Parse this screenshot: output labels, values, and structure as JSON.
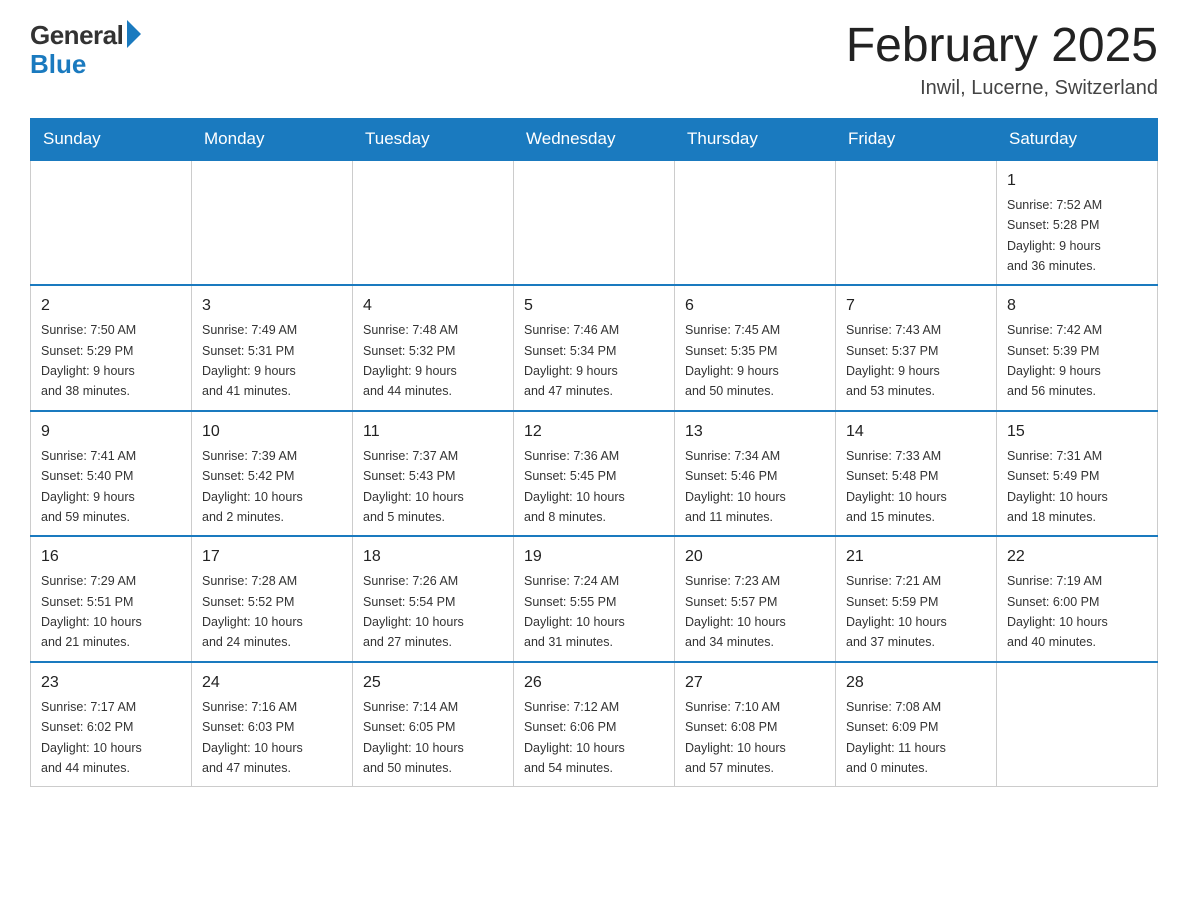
{
  "logo": {
    "general": "General",
    "blue": "Blue"
  },
  "title": "February 2025",
  "subtitle": "Inwil, Lucerne, Switzerland",
  "weekdays": [
    "Sunday",
    "Monday",
    "Tuesday",
    "Wednesday",
    "Thursday",
    "Friday",
    "Saturday"
  ],
  "weeks": [
    [
      {
        "day": "",
        "info": ""
      },
      {
        "day": "",
        "info": ""
      },
      {
        "day": "",
        "info": ""
      },
      {
        "day": "",
        "info": ""
      },
      {
        "day": "",
        "info": ""
      },
      {
        "day": "",
        "info": ""
      },
      {
        "day": "1",
        "info": "Sunrise: 7:52 AM\nSunset: 5:28 PM\nDaylight: 9 hours\nand 36 minutes."
      }
    ],
    [
      {
        "day": "2",
        "info": "Sunrise: 7:50 AM\nSunset: 5:29 PM\nDaylight: 9 hours\nand 38 minutes."
      },
      {
        "day": "3",
        "info": "Sunrise: 7:49 AM\nSunset: 5:31 PM\nDaylight: 9 hours\nand 41 minutes."
      },
      {
        "day": "4",
        "info": "Sunrise: 7:48 AM\nSunset: 5:32 PM\nDaylight: 9 hours\nand 44 minutes."
      },
      {
        "day": "5",
        "info": "Sunrise: 7:46 AM\nSunset: 5:34 PM\nDaylight: 9 hours\nand 47 minutes."
      },
      {
        "day": "6",
        "info": "Sunrise: 7:45 AM\nSunset: 5:35 PM\nDaylight: 9 hours\nand 50 minutes."
      },
      {
        "day": "7",
        "info": "Sunrise: 7:43 AM\nSunset: 5:37 PM\nDaylight: 9 hours\nand 53 minutes."
      },
      {
        "day": "8",
        "info": "Sunrise: 7:42 AM\nSunset: 5:39 PM\nDaylight: 9 hours\nand 56 minutes."
      }
    ],
    [
      {
        "day": "9",
        "info": "Sunrise: 7:41 AM\nSunset: 5:40 PM\nDaylight: 9 hours\nand 59 minutes."
      },
      {
        "day": "10",
        "info": "Sunrise: 7:39 AM\nSunset: 5:42 PM\nDaylight: 10 hours\nand 2 minutes."
      },
      {
        "day": "11",
        "info": "Sunrise: 7:37 AM\nSunset: 5:43 PM\nDaylight: 10 hours\nand 5 minutes."
      },
      {
        "day": "12",
        "info": "Sunrise: 7:36 AM\nSunset: 5:45 PM\nDaylight: 10 hours\nand 8 minutes."
      },
      {
        "day": "13",
        "info": "Sunrise: 7:34 AM\nSunset: 5:46 PM\nDaylight: 10 hours\nand 11 minutes."
      },
      {
        "day": "14",
        "info": "Sunrise: 7:33 AM\nSunset: 5:48 PM\nDaylight: 10 hours\nand 15 minutes."
      },
      {
        "day": "15",
        "info": "Sunrise: 7:31 AM\nSunset: 5:49 PM\nDaylight: 10 hours\nand 18 minutes."
      }
    ],
    [
      {
        "day": "16",
        "info": "Sunrise: 7:29 AM\nSunset: 5:51 PM\nDaylight: 10 hours\nand 21 minutes."
      },
      {
        "day": "17",
        "info": "Sunrise: 7:28 AM\nSunset: 5:52 PM\nDaylight: 10 hours\nand 24 minutes."
      },
      {
        "day": "18",
        "info": "Sunrise: 7:26 AM\nSunset: 5:54 PM\nDaylight: 10 hours\nand 27 minutes."
      },
      {
        "day": "19",
        "info": "Sunrise: 7:24 AM\nSunset: 5:55 PM\nDaylight: 10 hours\nand 31 minutes."
      },
      {
        "day": "20",
        "info": "Sunrise: 7:23 AM\nSunset: 5:57 PM\nDaylight: 10 hours\nand 34 minutes."
      },
      {
        "day": "21",
        "info": "Sunrise: 7:21 AM\nSunset: 5:59 PM\nDaylight: 10 hours\nand 37 minutes."
      },
      {
        "day": "22",
        "info": "Sunrise: 7:19 AM\nSunset: 6:00 PM\nDaylight: 10 hours\nand 40 minutes."
      }
    ],
    [
      {
        "day": "23",
        "info": "Sunrise: 7:17 AM\nSunset: 6:02 PM\nDaylight: 10 hours\nand 44 minutes."
      },
      {
        "day": "24",
        "info": "Sunrise: 7:16 AM\nSunset: 6:03 PM\nDaylight: 10 hours\nand 47 minutes."
      },
      {
        "day": "25",
        "info": "Sunrise: 7:14 AM\nSunset: 6:05 PM\nDaylight: 10 hours\nand 50 minutes."
      },
      {
        "day": "26",
        "info": "Sunrise: 7:12 AM\nSunset: 6:06 PM\nDaylight: 10 hours\nand 54 minutes."
      },
      {
        "day": "27",
        "info": "Sunrise: 7:10 AM\nSunset: 6:08 PM\nDaylight: 10 hours\nand 57 minutes."
      },
      {
        "day": "28",
        "info": "Sunrise: 7:08 AM\nSunset: 6:09 PM\nDaylight: 11 hours\nand 0 minutes."
      },
      {
        "day": "",
        "info": ""
      }
    ]
  ]
}
